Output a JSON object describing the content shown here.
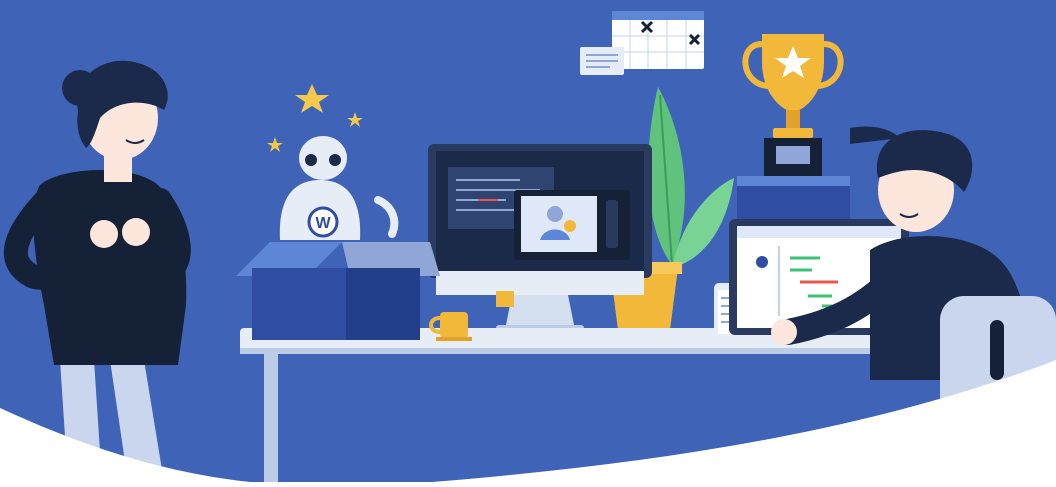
{
  "scene": {
    "description_free": true,
    "colors": {
      "background": "#3f64b7",
      "floor_wave": "#ffffff",
      "desk_top": "#e6edf7",
      "desk_edge": "#bccbe6",
      "box": "#2f4ea3",
      "box_dark": "#233f8c",
      "person_dark": "#142136",
      "hair": "#1b2a4a",
      "skin": "#fde6dc",
      "pants": "#c9d6ee",
      "trophy": "#f2b83a",
      "plant": "#5fc27d",
      "screen_dark": "#1c2a4a",
      "monitor_frame": "#2a3a5f",
      "accent_green": "#3cc07a",
      "accent_red": "#e8584f"
    },
    "logo_letter": "W",
    "icons": [
      "star-icon",
      "trophy-icon",
      "calendar-icon",
      "robot-icon",
      "plant-icon",
      "coffee-mug-icon",
      "phone-icon",
      "laptop-icon",
      "monitor-icon"
    ]
  }
}
